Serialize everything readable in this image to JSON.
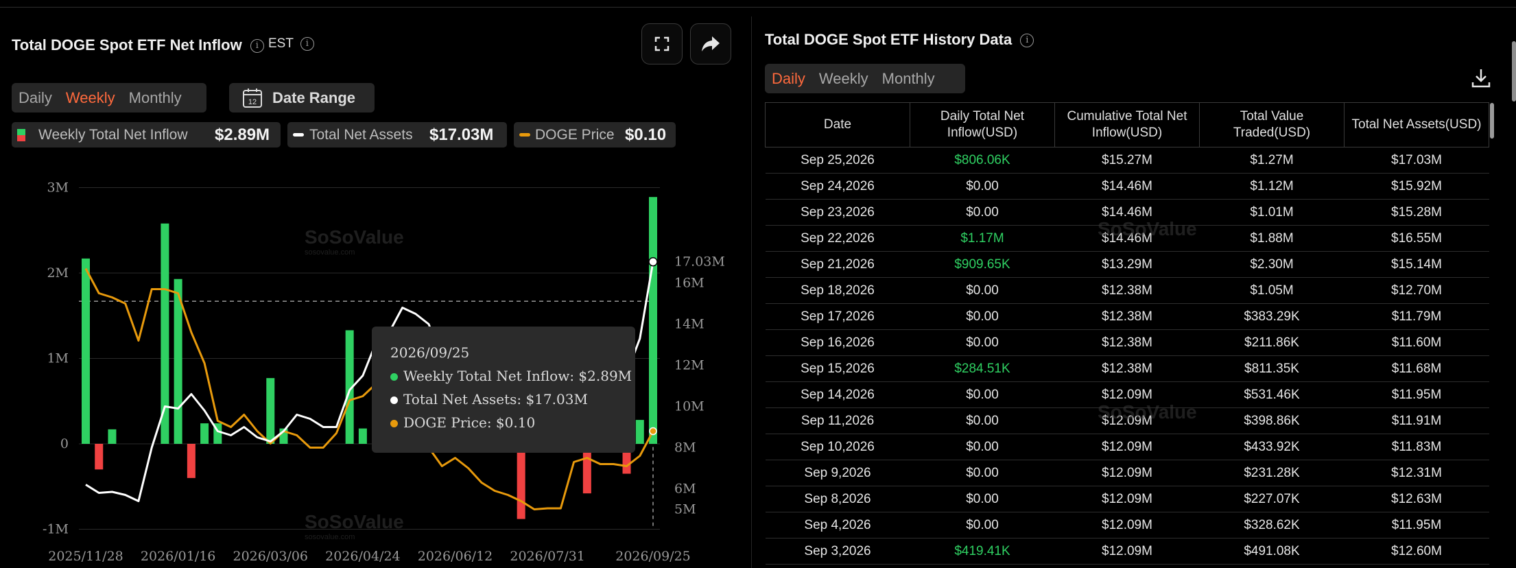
{
  "left": {
    "title": "Total DOGE Spot ETF Net Inflow",
    "timezone": "EST",
    "periods": [
      "Daily",
      "Weekly",
      "Monthly"
    ],
    "active_period": "Weekly",
    "date_range_label": "Date Range",
    "calendar_day": "12",
    "legend": [
      {
        "label": "Weekly Total Net Inflow",
        "value": "$2.89M"
      },
      {
        "label": "Total Net Assets",
        "value": "$17.03M"
      },
      {
        "label": "DOGE Price",
        "value": "$0.10"
      }
    ],
    "tooltip": {
      "date": "2026/09/25",
      "rows": [
        "Weekly Total Net Inflow: $2.89M",
        "Total Net Assets: $17.03M",
        "DOGE Price: $0.10"
      ]
    },
    "watermark": "SoSoValue",
    "watermark_sub": "sosovalue.com"
  },
  "chart_data": {
    "type": "bar",
    "x_tick_labels": [
      "2025/11/28",
      "2026/01/16",
      "2026/03/06",
      "2026/04/24",
      "2026/06/12",
      "2026/07/31",
      "2026/09/25"
    ],
    "left_axis": {
      "ticks": [
        "3M",
        "2M",
        "1M",
        "0",
        "-1M"
      ],
      "ylim": [
        -1,
        3
      ],
      "unit": "M USD"
    },
    "right_axis": {
      "ticks": [
        "17.03M",
        "16M",
        "14M",
        "12M",
        "10M",
        "8M",
        "6M",
        "5M"
      ],
      "ylim": [
        5,
        17.03
      ],
      "unit": "M USD"
    },
    "reference_line": 1.67,
    "colors": {
      "positive": "#2fd062",
      "negative": "#f04141",
      "assets": "#ffffff",
      "price": "#e89a0c"
    },
    "x": [
      "2025/11/28",
      "2025/12/05",
      "2025/12/12",
      "2025/12/19",
      "2025/12/26",
      "2026/01/02",
      "2026/01/09",
      "2026/01/16",
      "2026/01/23",
      "2026/01/30",
      "2026/02/06",
      "2026/02/13",
      "2026/02/20",
      "2026/02/27",
      "2026/03/06",
      "2026/03/13",
      "2026/03/20",
      "2026/03/27",
      "2026/04/03",
      "2026/04/10",
      "2026/04/17",
      "2026/04/24",
      "2026/05/01",
      "2026/05/08",
      "2026/05/15",
      "2026/05/22",
      "2026/05/29",
      "2026/06/05",
      "2026/06/12",
      "2026/06/19",
      "2026/06/26",
      "2026/07/03",
      "2026/07/10",
      "2026/07/17",
      "2026/07/24",
      "2026/07/31",
      "2026/08/07",
      "2026/08/14",
      "2026/08/21",
      "2026/08/28",
      "2026/09/04",
      "2026/09/11",
      "2026/09/18",
      "2026/09/25"
    ],
    "series": [
      {
        "name": "Weekly Total Net Inflow",
        "type": "bar",
        "axis": "left",
        "values": [
          2.17,
          -0.3,
          0.17,
          0,
          0,
          0,
          2.58,
          1.93,
          -0.4,
          0.24,
          0.24,
          0,
          0,
          0,
          0.77,
          0.18,
          0,
          0,
          0,
          0,
          1.33,
          0.18,
          0,
          0,
          0,
          0,
          0,
          0,
          0,
          0,
          0,
          0,
          0,
          -0.88,
          0,
          0,
          0,
          0,
          -0.58,
          0,
          0,
          -0.35,
          0.28,
          2.89
        ]
      },
      {
        "name": "Total Net Assets",
        "type": "line",
        "axis": "right",
        "values": [
          6.2,
          5.8,
          5.85,
          5.7,
          5.4,
          8.0,
          10.0,
          9.9,
          10.6,
          9.8,
          8.8,
          8.6,
          9.0,
          8.5,
          8.3,
          8.8,
          9.6,
          9.4,
          9.0,
          9.0,
          10.8,
          11.5,
          13.1,
          13.6,
          14.8,
          14.5,
          14.0,
          12.4,
          11.2,
          12.9,
          12.6,
          11.8,
          11.2,
          10.4,
          9.8,
          9.6,
          10.0,
          10.6,
          11.6,
          12.0,
          12.3,
          11.6,
          13.3,
          17.03
        ]
      },
      {
        "name": "DOGE Price",
        "type": "line",
        "axis": "right",
        "values": [
          16.7,
          15.5,
          15.3,
          15.0,
          13.2,
          15.7,
          15.7,
          15.5,
          13.6,
          12.1,
          9.3,
          9.0,
          9.6,
          8.8,
          8.2,
          8.8,
          8.6,
          8.0,
          8.0,
          8.7,
          10.3,
          10.5,
          11.1,
          10.4,
          10.3,
          9.2,
          8.0,
          7.1,
          7.5,
          7.0,
          6.3,
          5.9,
          5.7,
          5.4,
          5.0,
          5.05,
          5.05,
          7.3,
          7.5,
          7.2,
          7.2,
          7.1,
          7.6,
          8.8
        ]
      }
    ]
  },
  "right": {
    "title": "Total DOGE Spot ETF History Data",
    "periods": [
      "Daily",
      "Weekly",
      "Monthly"
    ],
    "active_period": "Daily",
    "columns": [
      "Date",
      "Daily Total Net Inflow(USD)",
      "Cumulative Total Net Inflow(USD)",
      "Total Value Traded(USD)",
      "Total Net Assets(USD)"
    ],
    "rows": [
      [
        "Sep 25,2026",
        "$806.06K",
        "$15.27M",
        "$1.27M",
        "$17.03M"
      ],
      [
        "Sep 24,2026",
        "$0.00",
        "$14.46M",
        "$1.12M",
        "$15.92M"
      ],
      [
        "Sep 23,2026",
        "$0.00",
        "$14.46M",
        "$1.01M",
        "$15.28M"
      ],
      [
        "Sep 22,2026",
        "$1.17M",
        "$14.46M",
        "$1.88M",
        "$16.55M"
      ],
      [
        "Sep 21,2026",
        "$909.65K",
        "$13.29M",
        "$2.30M",
        "$15.14M"
      ],
      [
        "Sep 18,2026",
        "$0.00",
        "$12.38M",
        "$1.05M",
        "$12.70M"
      ],
      [
        "Sep 17,2026",
        "$0.00",
        "$12.38M",
        "$383.29K",
        "$11.79M"
      ],
      [
        "Sep 16,2026",
        "$0.00",
        "$12.38M",
        "$211.86K",
        "$11.60M"
      ],
      [
        "Sep 15,2026",
        "$284.51K",
        "$12.38M",
        "$811.35K",
        "$11.68M"
      ],
      [
        "Sep 14,2026",
        "$0.00",
        "$12.09M",
        "$531.46K",
        "$11.95M"
      ],
      [
        "Sep 11,2026",
        "$0.00",
        "$12.09M",
        "$398.86K",
        "$11.91M"
      ],
      [
        "Sep 10,2026",
        "$0.00",
        "$12.09M",
        "$433.92K",
        "$11.83M"
      ],
      [
        "Sep 9,2026",
        "$0.00",
        "$12.09M",
        "$231.28K",
        "$12.31M"
      ],
      [
        "Sep 8,2026",
        "$0.00",
        "$12.09M",
        "$227.07K",
        "$12.63M"
      ],
      [
        "Sep 4,2026",
        "$0.00",
        "$12.09M",
        "$328.62K",
        "$11.95M"
      ],
      [
        "Sep 3,2026",
        "$419.41K",
        "$12.09M",
        "$491.08K",
        "$12.60M"
      ]
    ],
    "positive_color": "#2fd062"
  }
}
